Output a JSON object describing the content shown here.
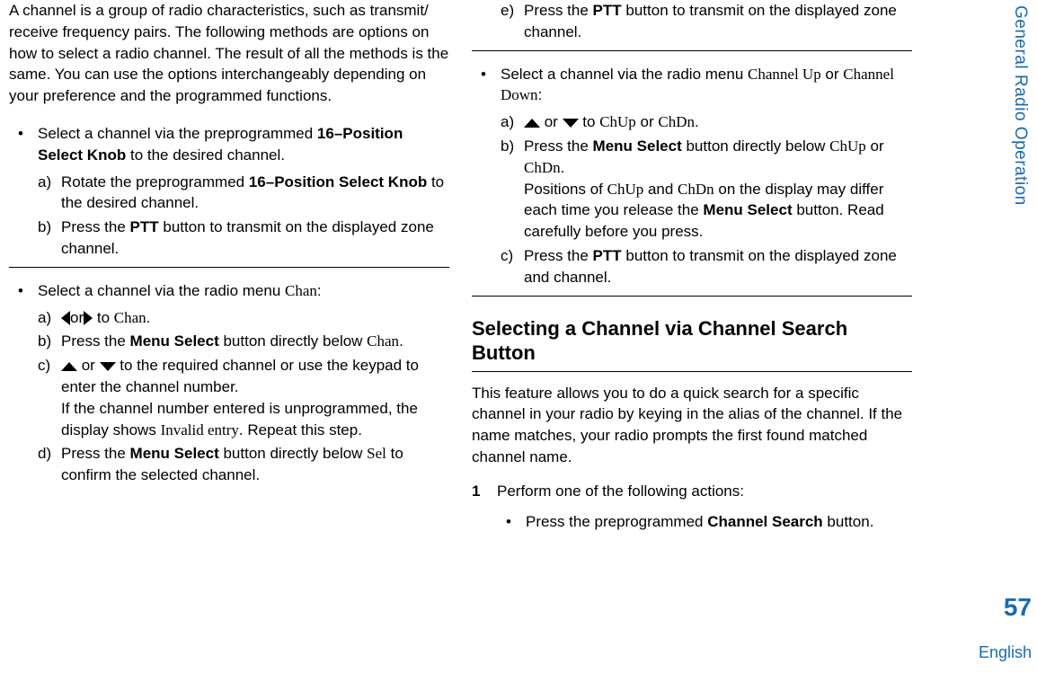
{
  "sideTab": "General Radio Operation",
  "pageNumber": "57",
  "language": "English",
  "col1": {
    "intro": "A channel is a group of radio characteristics, such as transmit/ receive frequency pairs. The following methods are options on how to select a radio channel. The result of all the methods is the same. You can use the options interchangeably depending on your preference and the programmed functions.",
    "bullet1": {
      "prefix": "Select a channel via the preprogrammed ",
      "boldKnob": "16–Position Select Knob",
      "suffix": " to the desired channel.",
      "a": {
        "marker": "a)",
        "prefix": "Rotate the preprogrammed ",
        "bold": "16–Position Select Knob",
        "suffix": " to the desired channel."
      },
      "b": {
        "marker": "b)",
        "prefix": "Press the ",
        "bold": "PTT",
        "suffix": " button to transmit on the displayed zone channel."
      }
    },
    "bullet2": {
      "prefix": "Select a channel via the radio menu ",
      "soft": "Chan",
      "suffix": ":",
      "a": {
        "marker": "a)",
        "or": "or",
        "to": " to ",
        "soft": "Chan",
        "end": "."
      },
      "b": {
        "marker": "b)",
        "prefix": "Press the ",
        "bold": "Menu Select",
        "mid": " button directly below ",
        "soft": "Chan",
        "end": "."
      },
      "c": {
        "marker": "c)",
        "or": " or ",
        "afterArrows": " to the required channel or use the keypad to enter the channel number.",
        "line2a": "If the channel number entered is unprogrammed, the display shows ",
        "soft": "Invalid entry",
        "line2b": ". Repeat this step."
      },
      "d": {
        "marker": "d)",
        "prefix": "Press the ",
        "bold": "Menu Select",
        "mid": " button directly below ",
        "soft": "Sel",
        "end": " to confirm the selected channel."
      }
    }
  },
  "col2": {
    "e": {
      "marker": "e)",
      "prefix": "Press the ",
      "bold": "PTT",
      "suffix": " button to transmit on the displayed zone channel."
    },
    "bullet3": {
      "prefix": "Select a channel via the radio menu ",
      "soft1": "Channel Up",
      "or1": " or ",
      "soft2": "Channel Down",
      "suffix": ":",
      "a": {
        "marker": "a)",
        "or": " or ",
        "to": " to ",
        "soft1": "ChUp",
        "or2": " or ",
        "soft2": "ChDn",
        "end": "."
      },
      "b": {
        "marker": "b)",
        "prefix": "Press the ",
        "bold": "Menu Select",
        "mid": " button directly below ",
        "soft1": "ChUp",
        "or": " or ",
        "soft2": "ChDn",
        "end": ".",
        "line2a": "Positions of ",
        "soft3": "ChUp",
        "line2b": " and ",
        "soft4": "ChDn",
        "line2c": " on the display may differ each time you release the ",
        "bold2": "Menu Select",
        "line2d": " button. Read carefully before you press."
      },
      "c": {
        "marker": "c)",
        "prefix": "Press the ",
        "bold": "PTT",
        "suffix": " button to transmit on the displayed zone and channel."
      }
    },
    "heading": "Selecting a Channel via Channel Search Button",
    "headingBody": "This feature allows you to do a quick search for a specific channel in your radio by keying in the alias of the channel. If the name matches, your radio prompts the first found matched channel name.",
    "step1": {
      "marker": "1",
      "text": "Perform one of the following actions:",
      "sub": {
        "prefix": "Press the preprogrammed ",
        "bold": "Channel Search",
        "suffix": " button."
      }
    }
  }
}
